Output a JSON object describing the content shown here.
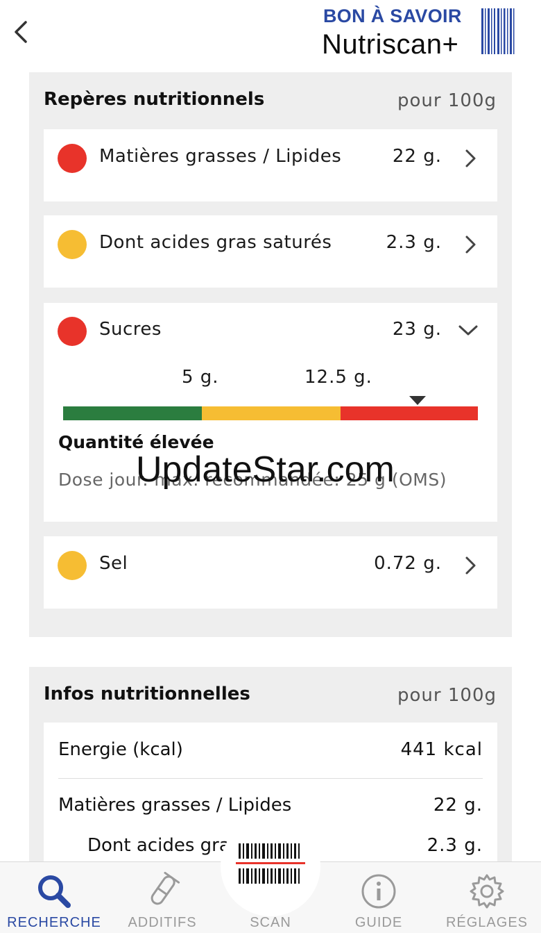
{
  "header": {
    "back_label": "<",
    "brand_top": "BON À SAVOIR",
    "brand_bottom": "Nutriscan+"
  },
  "reperes": {
    "title": "Repères nutritionnels",
    "unit": "pour 100g",
    "items": [
      {
        "label": "Matières grasses / Lipides",
        "value": "22 g.",
        "level": "red",
        "expanded": false
      },
      {
        "label": "Dont acides gras saturés",
        "value": "2.3 g.",
        "level": "yellow",
        "expanded": false
      },
      {
        "label": "Sucres",
        "value": "23 g.",
        "level": "red",
        "expanded": true
      },
      {
        "label": "Sel",
        "value": "0.72 g.",
        "level": "yellow",
        "expanded": false
      }
    ],
    "sugar_detail": {
      "low_threshold": "5 g.",
      "high_threshold": "12.5 g.",
      "marker_fraction": 0.855,
      "level_title": "Quantité élevée",
      "note": "Dose jour. max. recommandée: 25 g (OMS)"
    }
  },
  "infos": {
    "title": "Infos nutritionnelles",
    "unit": "pour 100g",
    "rows": [
      {
        "label": "Energie (kcal)",
        "value": "441 kcal"
      },
      {
        "label": "Matières grasses / Lipides",
        "value": "22 g."
      },
      {
        "label": "Dont acides gras saturés",
        "value": "2.3 g."
      }
    ]
  },
  "watermark": "UpdateStar.com",
  "tabs": [
    {
      "label": "RECHERCHE",
      "icon": "search-icon",
      "active": true
    },
    {
      "label": "ADDITIFS",
      "icon": "test-tube-icon",
      "active": false
    },
    {
      "label": "SCAN",
      "icon": "barcode-icon",
      "active": false
    },
    {
      "label": "GUIDE",
      "icon": "info-icon",
      "active": false
    },
    {
      "label": "RÉGLAGES",
      "icon": "gear-icon",
      "active": false
    }
  ],
  "colors": {
    "red": "#e8332a",
    "yellow": "#f6bd33",
    "green": "#2b7d3f",
    "brand_blue": "#2a49a3"
  }
}
